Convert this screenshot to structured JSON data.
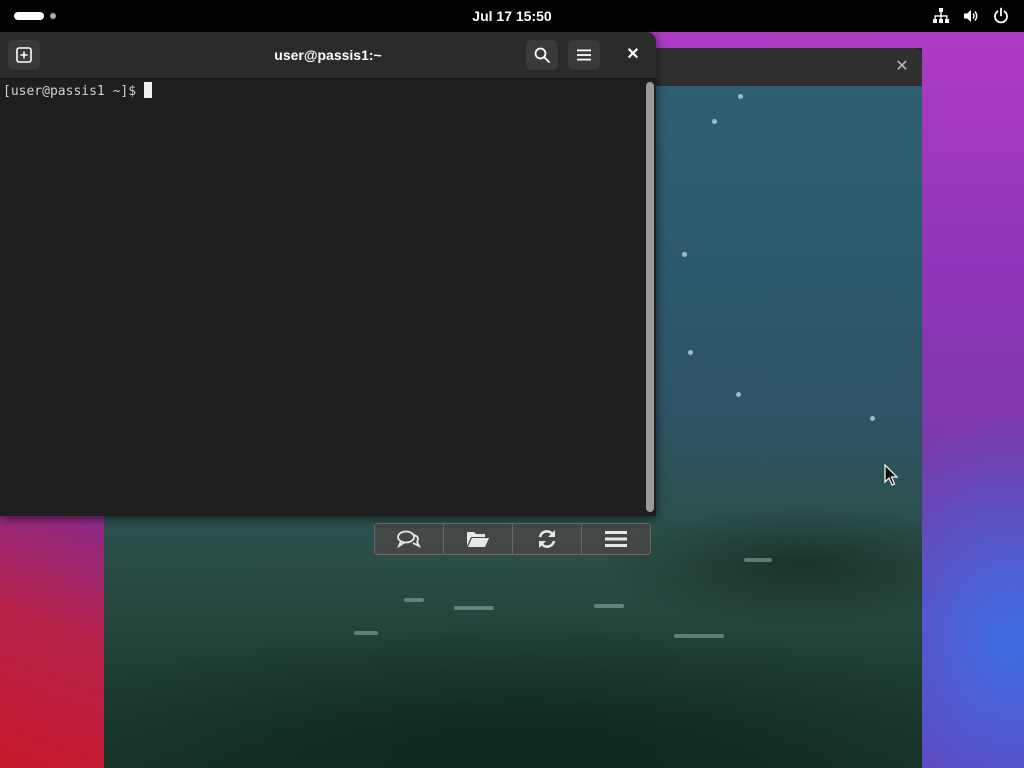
{
  "topbar": {
    "clock": "Jul 17  15:50",
    "tray_icons": [
      "network-icon",
      "volume-icon",
      "power-icon"
    ]
  },
  "terminal": {
    "title": "user@passis1:~",
    "prompt": "[user@passis1 ~]$",
    "buttons": [
      "new-tab-icon",
      "search-icon",
      "menu-icon",
      "close-icon"
    ],
    "close_glyph": "✕"
  },
  "viewer": {
    "close_glyph": "✕",
    "toolbar": [
      "comment-icon",
      "folder-icon",
      "refresh-icon",
      "menu-icon"
    ]
  },
  "colors": {
    "terminal_bg": "#1e1e1e",
    "header_bg": "#2b2b2b",
    "topbar_bg": "#000000"
  }
}
